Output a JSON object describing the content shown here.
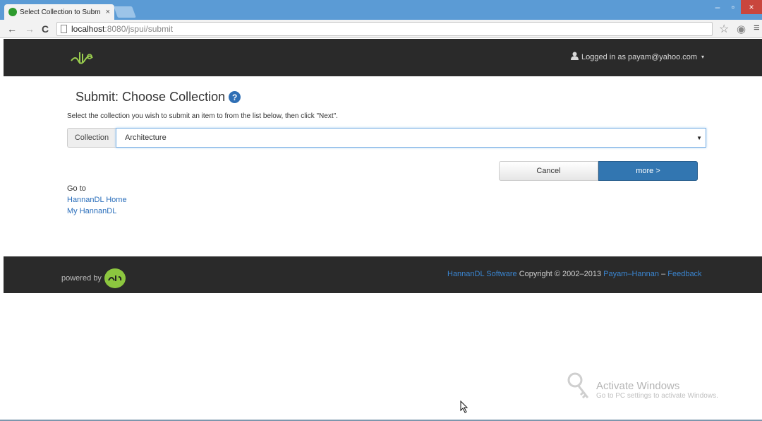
{
  "browser": {
    "tab_title": "Select Collection to Subm",
    "tab_close": "×",
    "url_host": "localhost",
    "url_path": ":8080/jspui/submit",
    "window_buttons": [
      "–",
      "▫",
      "×"
    ],
    "icons": [
      "back-arrow-icon",
      "forward-arrow-icon",
      "reload-icon",
      "page-icon",
      "star-icon",
      "globe-icon",
      "menu-icon"
    ]
  },
  "header": {
    "login_text": "Logged in as payam@yahoo.com",
    "caret": "▾"
  },
  "main": {
    "title": "Submit: Choose Collection",
    "help_icon": "?",
    "instructions": "Select the collection you wish to submit an item to from the list below, then click \"Next\".",
    "collection_label": "Collection",
    "collection_value": "Architecture",
    "cancel_label": "Cancel",
    "more_label": "more >",
    "goto_label": "Go to",
    "goto_links": [
      "HannanDL Home",
      "My HannanDL"
    ]
  },
  "footer": {
    "powered_by": "powered by",
    "software_link": "HannanDL Software",
    "copyright": " Copyright © 2002–2013 ",
    "author_link": "Payam–Hannan",
    "separator": " – ",
    "feedback_link": "Feedback"
  },
  "watermark": {
    "title": "Activate Windows",
    "subtitle": "Go to PC settings to activate Windows."
  },
  "colors": {
    "header_bg": "#2a2a2a",
    "primary_button": "#3276b1",
    "link": "#2a6ebb",
    "footer_link": "#3a85d0",
    "chrome_frame": "#5b9bd5"
  }
}
